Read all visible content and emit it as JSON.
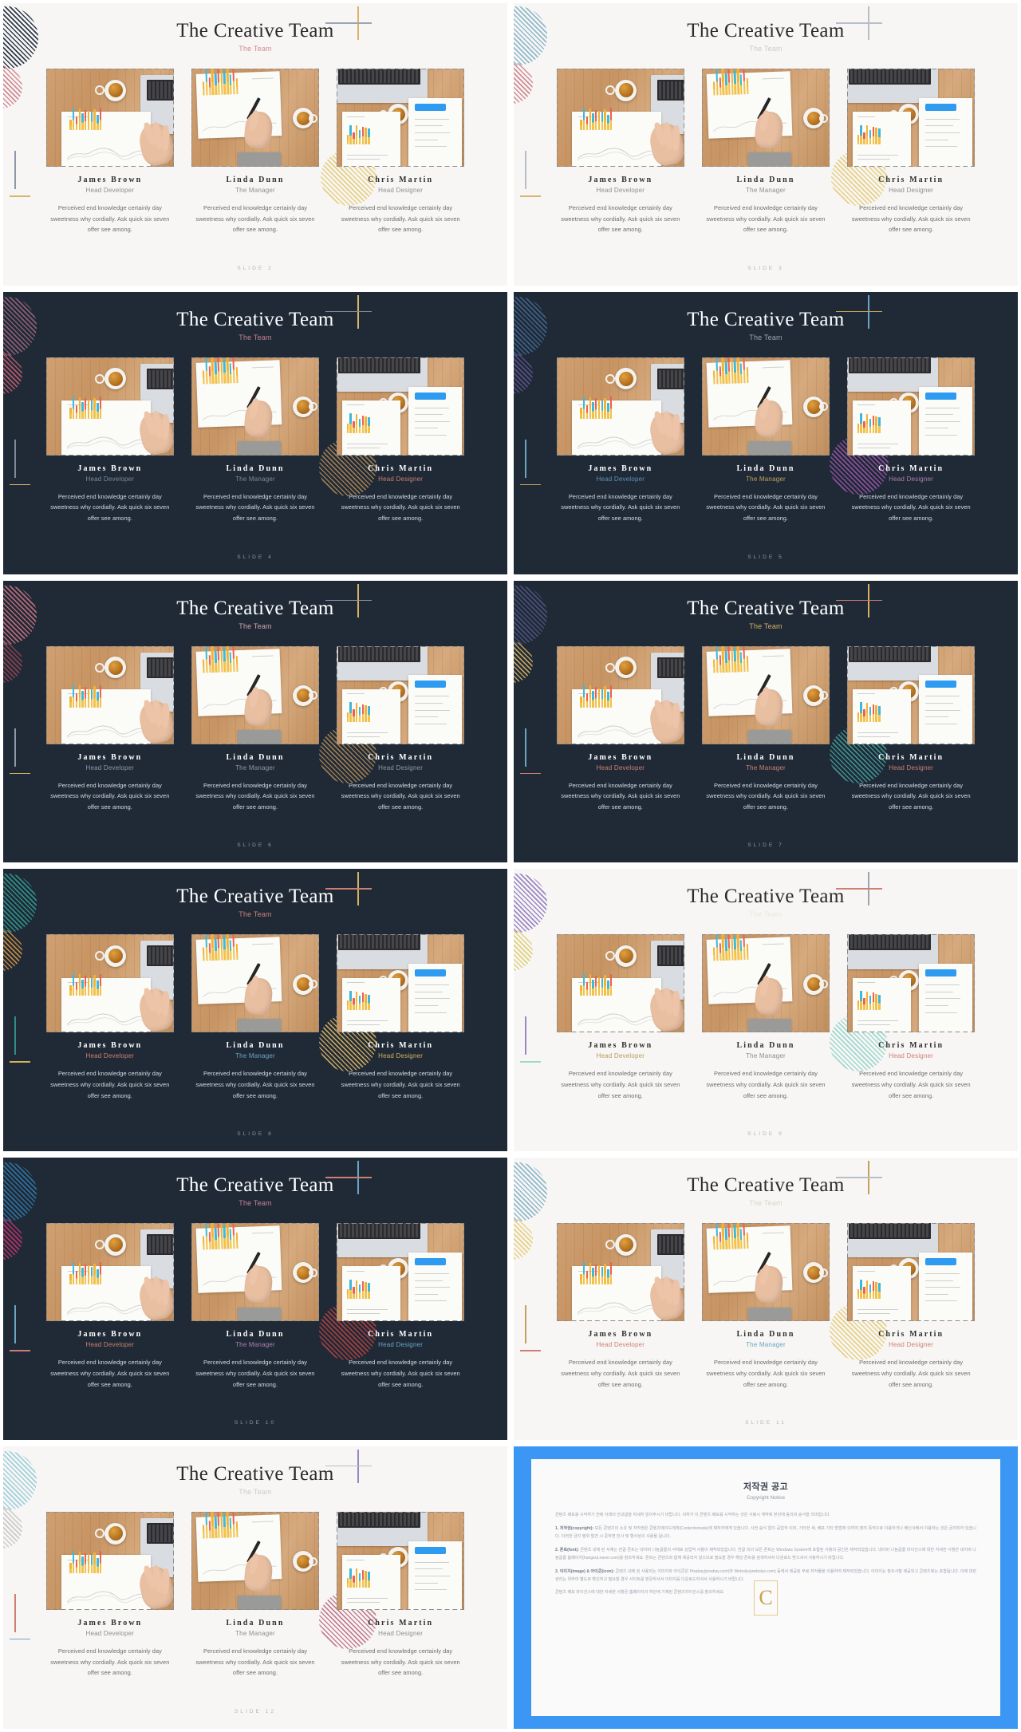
{
  "deck": {
    "title": "The Creative Team",
    "subtitle": "The Team",
    "members": [
      {
        "name": "James Brown",
        "role": "Head Developer",
        "desc": "Perceived end knowledge certainly day sweetness why cordially. Ask quick six seven offer see among."
      },
      {
        "name": "Linda Dunn",
        "role": "The Manager",
        "desc": "Perceived end knowledge certainly day sweetness why cordially. Ask quick six seven offer see among."
      },
      {
        "name": "Chris Martin",
        "role": "Head Designer",
        "desc": "Perceived end knowledge certainly day sweetness why cordially. Ask quick six seven offer see among."
      }
    ]
  },
  "slides": [
    {
      "id": "s1",
      "theme": "light",
      "number": "SLIDE 2",
      "subtitle_color": "#d48a94",
      "role_colors": [
        "#8e8e8e",
        "#8e8e8e",
        "#8e8e8e"
      ]
    },
    {
      "id": "s2",
      "theme": "light",
      "number": "SLIDE 3",
      "subtitle_color": "#c9ccd2",
      "role_colors": [
        "#8e8e8e",
        "#8e8e8e",
        "#8e8e8e"
      ]
    },
    {
      "id": "s3",
      "theme": "dark",
      "number": "SLIDE 4",
      "subtitle_color": "#c87f95",
      "role_colors": [
        "#7f8a98",
        "#7f8a98",
        "#cf7f72"
      ]
    },
    {
      "id": "s4",
      "theme": "dark",
      "number": "SLIDE 5",
      "subtitle_color": "#9aa4b2",
      "role_colors": [
        "#5e93b8",
        "#c2a15e",
        "#b07fae"
      ]
    },
    {
      "id": "s5",
      "theme": "dark",
      "number": "SLIDE 6",
      "subtitle_color": "#d3a4ad",
      "role_colors": [
        "#8e99a6",
        "#8e99a6",
        "#8e99a6"
      ]
    },
    {
      "id": "s6",
      "theme": "dark",
      "number": "SLIDE 7",
      "subtitle_color": "#d6b15e",
      "role_colors": [
        "#cf7f72",
        "#cf7f72",
        "#cf7f72"
      ]
    },
    {
      "id": "s7",
      "theme": "dark",
      "number": "SLIDE 8",
      "subtitle_color": "#cf7f72",
      "role_colors": [
        "#cf7f72",
        "#6aa6c4",
        "#d6b15e"
      ]
    },
    {
      "id": "s8",
      "theme": "light",
      "number": "SLIDE 9",
      "subtitle_color": "#ece8d6",
      "role_colors": [
        "#b79b5e",
        "#8e8e8e",
        "#cf7f72"
      ]
    },
    {
      "id": "s9",
      "theme": "dark",
      "number": "SLIDE 10",
      "subtitle_color": "#c87f95",
      "role_colors": [
        "#cf7f72",
        "#b07fae",
        "#6aa6c4"
      ]
    },
    {
      "id": "s10",
      "theme": "light",
      "number": "SLIDE 11",
      "subtitle_color": "#d9d6cc",
      "role_colors": [
        "#cf7f72",
        "#6aa6c4",
        "#cf7f72"
      ]
    },
    {
      "id": "s11",
      "theme": "light",
      "number": "SLIDE 12",
      "subtitle_color": "#c9ccd2",
      "role_colors": [
        "#8e8e8e",
        "#8e8e8e",
        "#8e8e8e"
      ]
    }
  ],
  "copyright": {
    "title": "저작권 공고",
    "subtitle": "Copyright Notice",
    "watermark": "C",
    "intro": "콘텐츠 배포를 시작하기 전에 아래의 안내글을 자세히 읽어주시기 바랍니다. 귀하가 이 콘텐츠 배포를 시작하는 것은 사용시 계약에 본것에 동의와 승낙을 의미합니다.",
    "p1_label": "1. 저작권(copyright):",
    "p1": "모든 콘텐츠의 소유 및 저작권은 콘텐츠메이드에게(Contentsmade)에 제작자에게 있습니다. 사전 승낙 없이 공업적 이외, 기타한 새, 배포 기타 방법에 의하여 영리 목적으로 이용하거나 배신사에서 이용하는 것은 금지되어 있습니다. 이러한 금지 행위 발견 시 준하면 민사 및 형사상의 사용될 됩니다.",
    "p2_label": "2. 폰트(font):",
    "p2": "콘텐츠 내에 된 서체는 한글 폰트는 네이버 나눔글꼴의 서체로 상업적 사용이 제작되었습니다. 한글 외의 모든 폰트는 Windows System에 포함된 사용의 공인은 제작되었습니다. 네이버 나눔글꼴 라이선스에 대한 자세한 사항은 네이버 나눔글꼴 홈페이지(hangeul.naver.com)를 참조하세요. 폰트는 콘텐츠와 함께 제공되지 않으므로 필요할 경우 해당 폰트를 검색하셔서 다운로드 받으셔서 사용하시기 바랍니다.",
    "p3_label": "3. 이미지(image) & 아이콘(icon):",
    "p3": "콘텐츠 내에 된 사용되는 이미지와 아이콘은 Pixabay(pixabay.com)와 Webolys(webolys.com) 등에서 제공된 무료 저작물을 이용하여 제작되었습니다. 이미지는 참조사항 제공되고 콘텐츠에는 포함됩니다. 이에 대한 권리는 위하여 별도로 확인하고 필요할 경우 사이트를 방문하셔서 이미지를 다운로드하셔서 사용하시기 바랍니다.",
    "footer": "콘텐츠 배포 라이선스에 대한 자세한 사항은 홈페이지의 하단에 기재된 콘텐츠라이선스를 참조하세요."
  }
}
